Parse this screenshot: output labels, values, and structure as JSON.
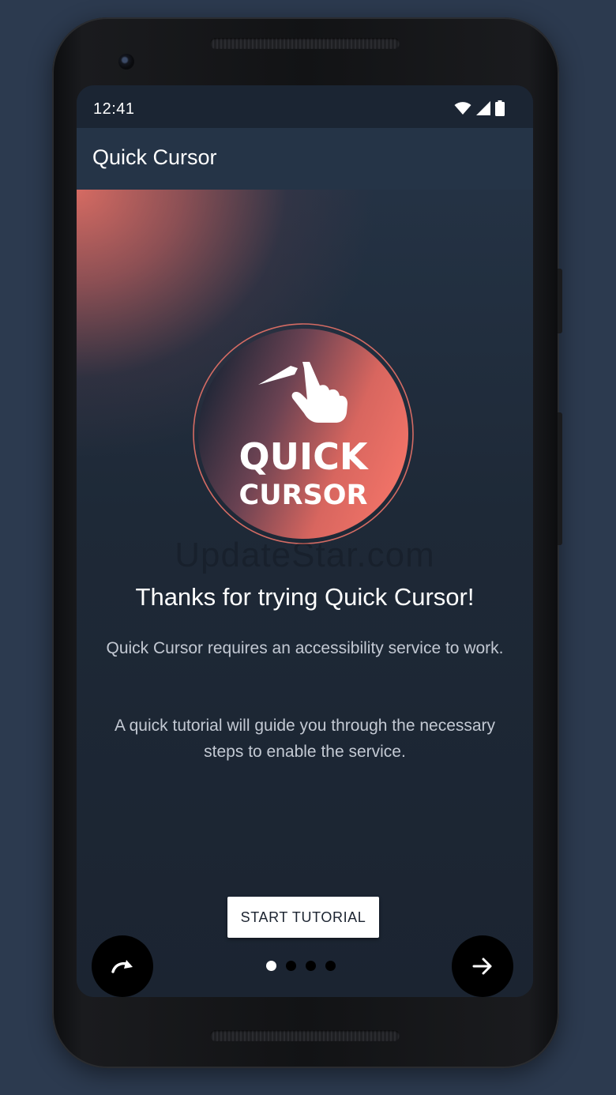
{
  "status_bar": {
    "time": "12:41",
    "icons": [
      "wifi-icon",
      "signal-icon",
      "battery-icon"
    ]
  },
  "app_bar": {
    "title": "Quick Cursor"
  },
  "logo": {
    "line1": "QUICK",
    "line2": "CURSOR",
    "icon": "hand-pointer-icon"
  },
  "watermark": "UpdateStar.com",
  "intro": {
    "headline": "Thanks for trying Quick Cursor!",
    "paragraph1": "Quick Cursor requires an accessibility service to work.",
    "paragraph2": "A quick tutorial will guide you through the necessary steps to enable the service."
  },
  "buttons": {
    "start_tutorial": "START TUTORIAL",
    "skip_icon": "redo-arrow-icon",
    "next_icon": "arrow-right-icon"
  },
  "pager": {
    "total": 4,
    "active_index": 0
  },
  "colors": {
    "background": "#2c3a4f",
    "app_bar": "#253447",
    "accent_coral": "#f07268",
    "screen_bg": "#1c2532"
  }
}
